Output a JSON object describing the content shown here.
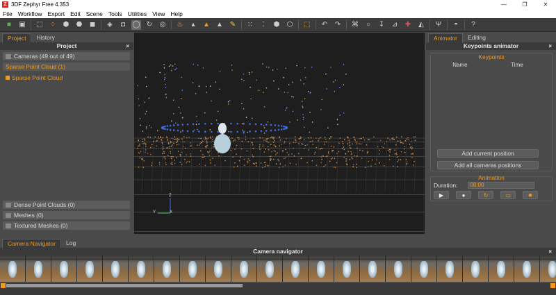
{
  "window": {
    "title": "3DF Zephyr Free 4.353",
    "app_icon_letter": "Z",
    "minimize": "—",
    "maximize": "❐",
    "close": "✕"
  },
  "menu": [
    "File",
    "Workflow",
    "Export",
    "Edit",
    "Scene",
    "Tools",
    "Utilities",
    "View",
    "Help"
  ],
  "left_panel": {
    "tabs": [
      {
        "label": "Project",
        "active": true
      },
      {
        "label": "History",
        "active": false
      }
    ],
    "header": "Project",
    "close": "×",
    "cameras": "Cameras (49 out of 49)",
    "sparse_group": "Sparse Point Cloud (1)",
    "sparse_item": "Sparse Point Cloud",
    "dense": "Dense Point Clouds (0)",
    "meshes": "Meshes (0)",
    "textured": "Textured Meshes (0)"
  },
  "viewport": {
    "axis_z": "Z",
    "axis_y": "Y",
    "axis_x": "X"
  },
  "right_panel": {
    "tabs": [
      {
        "label": "Animator",
        "active": true
      },
      {
        "label": "Editing",
        "active": false
      }
    ],
    "header": "Keypoints animator",
    "close": "×",
    "keypoints_title": "Keypoints",
    "col_name": "Name",
    "col_time": "Time",
    "add_current": "Add current position",
    "add_all": "Add all cameras positions",
    "animation_title": "Animation",
    "duration_label": "Duration:",
    "duration_value": "00:00",
    "play_icon": "▶",
    "record_icon": "●",
    "loop_icon": "↻",
    "save_icon": "▭",
    "settings_icon": "✹"
  },
  "bottom": {
    "tabs": [
      {
        "label": "Camera Navigator",
        "active": true
      },
      {
        "label": "Log",
        "active": false
      }
    ],
    "header": "Camera navigator",
    "close": "×",
    "thumbnail_count": 22
  },
  "colors": {
    "accent": "#f39a1f",
    "panel": "#4a4a4a",
    "viewport_bg": "#1e1e1e"
  }
}
